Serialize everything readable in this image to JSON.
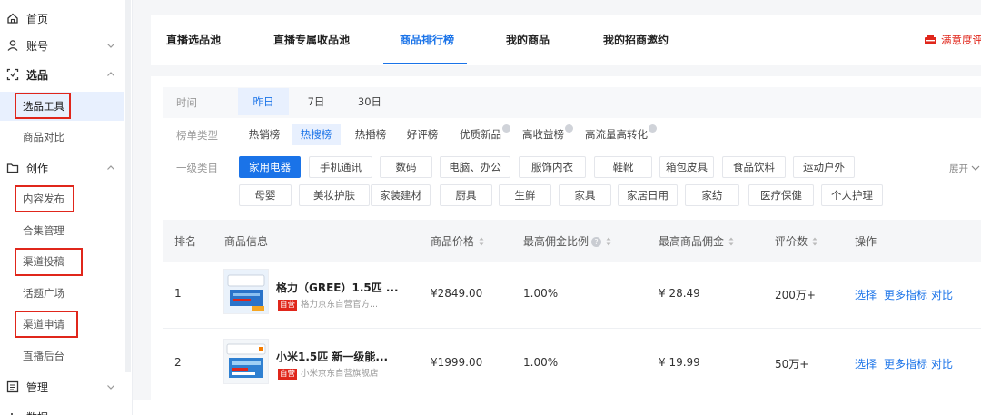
{
  "sidebar": {
    "items": [
      {
        "label": "首页",
        "icon": "home-icon"
      },
      {
        "label": "账号",
        "icon": "user-icon",
        "chevron": "down"
      },
      {
        "label": "选品",
        "icon": "select-icon",
        "chevron": "up"
      },
      {
        "label": "创作",
        "icon": "folder-icon",
        "chevron": "up"
      },
      {
        "label": "管理",
        "icon": "list-icon",
        "chevron": "down"
      },
      {
        "label": "数据",
        "icon": "chart-icon",
        "chevron": "down"
      }
    ],
    "sub_selection": [
      "选品工具",
      "商品对比"
    ],
    "sub_creation": [
      "内容发布",
      "合集管理",
      "渠道投稿",
      "话题广场",
      "渠道申请",
      "直播后台"
    ]
  },
  "tabs": [
    "直播选品池",
    "直播专属收品池",
    "商品排行榜",
    "我的商品",
    "我的招商邀约"
  ],
  "active_tab": "商品排行榜",
  "survey_label": "满意度评",
  "filters": {
    "time_label": "时间",
    "time_options": [
      "昨日",
      "7日",
      "30日"
    ],
    "list_type_label": "榜单类型",
    "list_types": [
      "热销榜",
      "热搜榜",
      "热播榜",
      "好评榜",
      "优质新品",
      "高收益榜",
      "高流量高转化"
    ],
    "category_label": "一级类目",
    "categories_row1": [
      "家用电器",
      "手机通讯",
      "数码",
      "电脑、办公",
      "服饰内衣",
      "鞋靴",
      "箱包皮具",
      "食品饮料",
      "运动户外"
    ],
    "categories_row2": [
      "母婴",
      "美妆护肤",
      "家装建材",
      "厨具",
      "生鲜",
      "家具",
      "家居日用",
      "家纺",
      "医疗保健",
      "个人护理"
    ],
    "expand_label": "展开"
  },
  "table": {
    "headers": [
      "排名",
      "商品信息",
      "商品价格",
      "最高佣金比例",
      "最高商品佣金",
      "评价数",
      "操作"
    ],
    "rows": [
      {
        "rank": "1",
        "name": "格力（GREE）1.5匹 ...",
        "tag": "自营",
        "shop": "格力京东自营官方...",
        "price": "¥2849.00",
        "rate": "1.00%",
        "commission": "¥ 28.49",
        "reviews": "200万+"
      },
      {
        "rank": "2",
        "name": "小米1.5匹 新一级能...",
        "tag": "自营",
        "shop": "小米京东自营旗舰店",
        "price": "¥1999.00",
        "rate": "1.00%",
        "commission": "¥ 19.99",
        "reviews": "50万+"
      }
    ],
    "actions": [
      "选择",
      "更多指标",
      "对比"
    ]
  },
  "colors": {
    "accent": "#1a73e8",
    "highlight_box": "#e0261b"
  }
}
